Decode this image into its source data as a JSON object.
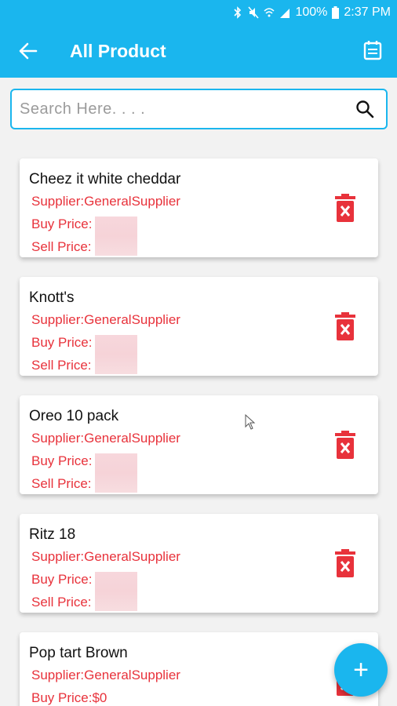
{
  "status_bar": {
    "battery": "100%",
    "time": "2:37 PM"
  },
  "appbar": {
    "title": "All Product"
  },
  "search": {
    "placeholder": "Search Here. . . ."
  },
  "products": [
    {
      "name": "Cheez it white cheddar",
      "supplier": "Supplier:GeneralSupplier",
      "buy": "Buy Price:",
      "sell": "Sell Price:"
    },
    {
      "name": "Knott's",
      "supplier": "Supplier:GeneralSupplier",
      "buy": "Buy Price:",
      "sell": "Sell Price:"
    },
    {
      "name": "Oreo 10 pack",
      "supplier": "Supplier:GeneralSupplier",
      "buy": "Buy Price:",
      "sell": "Sell Price:"
    },
    {
      "name": "Ritz 18",
      "supplier": "Supplier:GeneralSupplier",
      "buy": "Buy Price:",
      "sell": "Sell Price:"
    },
    {
      "name": "Pop tart Brown",
      "supplier": "Supplier:GeneralSupplier",
      "buy": "Buy Price:$0",
      "sell": ""
    }
  ],
  "colors": {
    "accent": "#1ab6ee",
    "red": "#e8323b"
  }
}
